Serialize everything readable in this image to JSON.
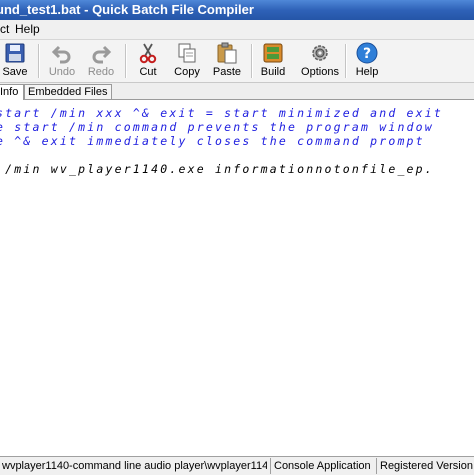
{
  "window": {
    "title": "und_test1.bat - Quick Batch File Compiler"
  },
  "menu": {
    "items": [
      "ct",
      "Help"
    ]
  },
  "toolbar": {
    "buttons": [
      {
        "label": "Save",
        "icon": "save-icon",
        "enabled": true
      },
      {
        "label": "Undo",
        "icon": "undo-icon",
        "enabled": false
      },
      {
        "label": "Redo",
        "icon": "redo-icon",
        "enabled": false
      },
      {
        "label": "Cut",
        "icon": "scissors-icon",
        "enabled": true
      },
      {
        "label": "Copy",
        "icon": "copy-icon",
        "enabled": true
      },
      {
        "label": "Paste",
        "icon": "paste-icon",
        "enabled": true
      },
      {
        "label": "Build",
        "icon": "build-icon",
        "enabled": true
      },
      {
        "label": "Options",
        "icon": "gear-icon",
        "enabled": true
      },
      {
        "label": "Help",
        "icon": "help-icon",
        "enabled": true
      }
    ]
  },
  "tabs": [
    "Info",
    "Embedded Files"
  ],
  "editor": {
    "lines": [
      "start /min xxx ^& exit = start minimized and exit",
      "e start /min command prevents the program window",
      "e ^& exit immediately closes the command prompt",
      "",
      " /min wv_player1140.exe informationnotonfile_ep."
    ]
  },
  "statusbar": {
    "path": "wvplayer1140-command line audio player\\wvplayer114",
    "type": "Console Application",
    "registration": "Registered Version"
  },
  "colors": {
    "title_bar": "#2f62b8",
    "comment_text": "#2020e0",
    "command_text": "#000000"
  }
}
